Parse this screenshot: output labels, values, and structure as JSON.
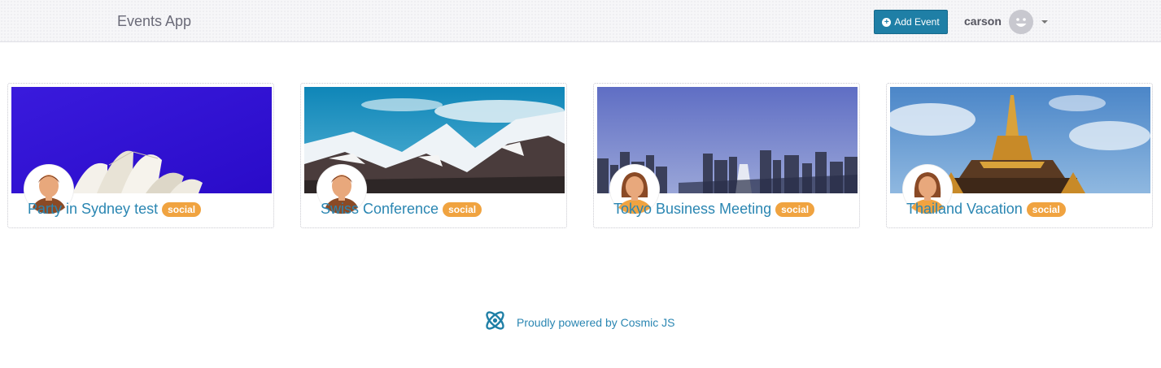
{
  "navbar": {
    "brand": "Events App",
    "add_event_label": "Add Event",
    "username": "carson"
  },
  "events": [
    {
      "title": "Party in Sydney test",
      "tag": "social"
    },
    {
      "title": "Swiss Conference",
      "tag": "social"
    },
    {
      "title": "Tokyo Business Meeting",
      "tag": "social"
    },
    {
      "title": "Thailand Vacation",
      "tag": "social"
    }
  ],
  "footer": {
    "text": "Proudly powered by Cosmic JS"
  },
  "colors": {
    "accent": "#1f7fa6",
    "link": "#2a86b2",
    "badge": "#f0a340"
  }
}
